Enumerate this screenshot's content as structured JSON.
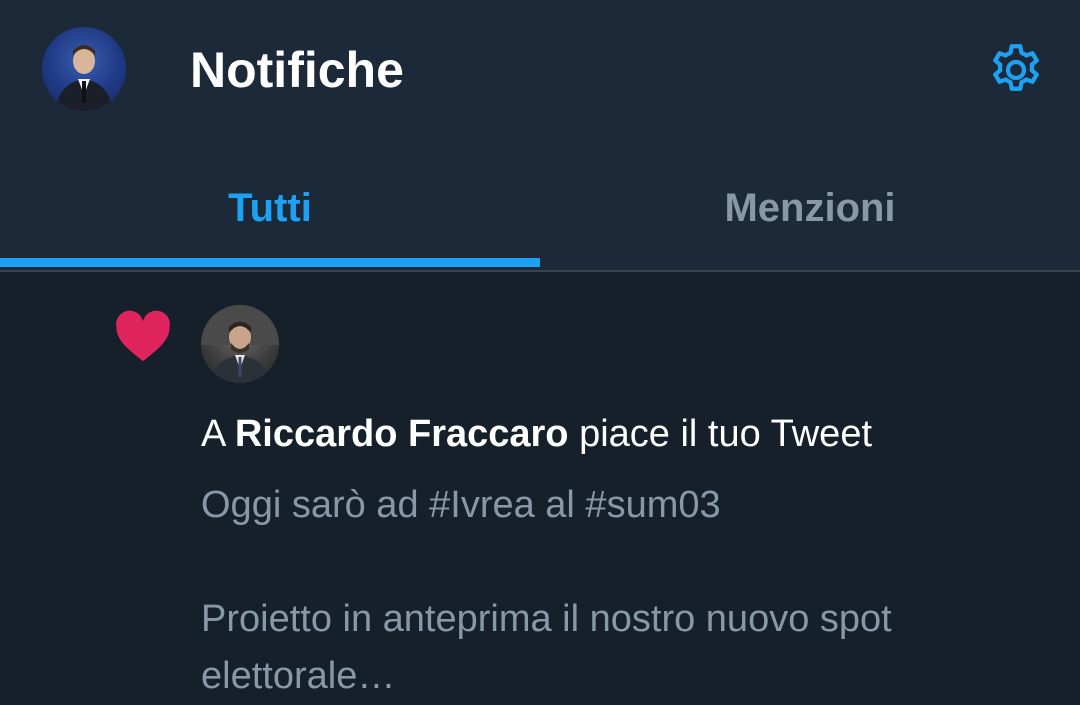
{
  "header": {
    "title": "Notifiche",
    "avatar_icon": "profile-avatar",
    "settings_icon": "gear-icon"
  },
  "tabs": [
    {
      "label": "Tutti",
      "active": true
    },
    {
      "label": "Menzioni",
      "active": false
    }
  ],
  "notification": {
    "icon": "heart-icon",
    "prefix": "A ",
    "user_name": "Riccardo Fraccaro",
    "suffix": " piace il tuo Tweet",
    "tweet_text": "Oggi sarò ad #Ivrea al #sum03\n\nProietto in anteprima il nostro nuovo spot elettorale…"
  },
  "colors": {
    "background": "#15202b",
    "header_bg": "#1c2938",
    "accent": "#1da1f2",
    "like": "#e0245e",
    "secondary_text": "#8899a6"
  }
}
